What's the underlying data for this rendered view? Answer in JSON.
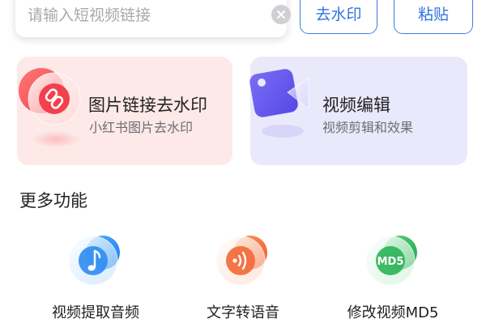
{
  "search": {
    "placeholder": "请输入短视频链接"
  },
  "actions": {
    "watermark_label": "去水印",
    "paste_label": "粘贴"
  },
  "cards": [
    {
      "title": "图片链接去水印",
      "subtitle": "小红书图片去水印",
      "icon": "link-icon"
    },
    {
      "title": "视频编辑",
      "subtitle": "视频剪辑和效果",
      "icon": "video-edit-icon"
    }
  ],
  "more": {
    "title": "更多功能",
    "items": [
      {
        "label": "视频提取音频",
        "icon": "music-note-icon"
      },
      {
        "label": "文字转语音",
        "icon": "sound-wave-icon"
      },
      {
        "label": "修改视频MD5",
        "icon": "md5-icon",
        "icon_text": "MD5"
      }
    ]
  },
  "colors": {
    "accent": "#2f74e0",
    "card_red_bg": "#fde9e7",
    "card_purple_bg": "#eae9fb",
    "icon_blue": "#2e8cf0",
    "icon_orange": "#f26a3a",
    "icon_green": "#2fb45a"
  }
}
